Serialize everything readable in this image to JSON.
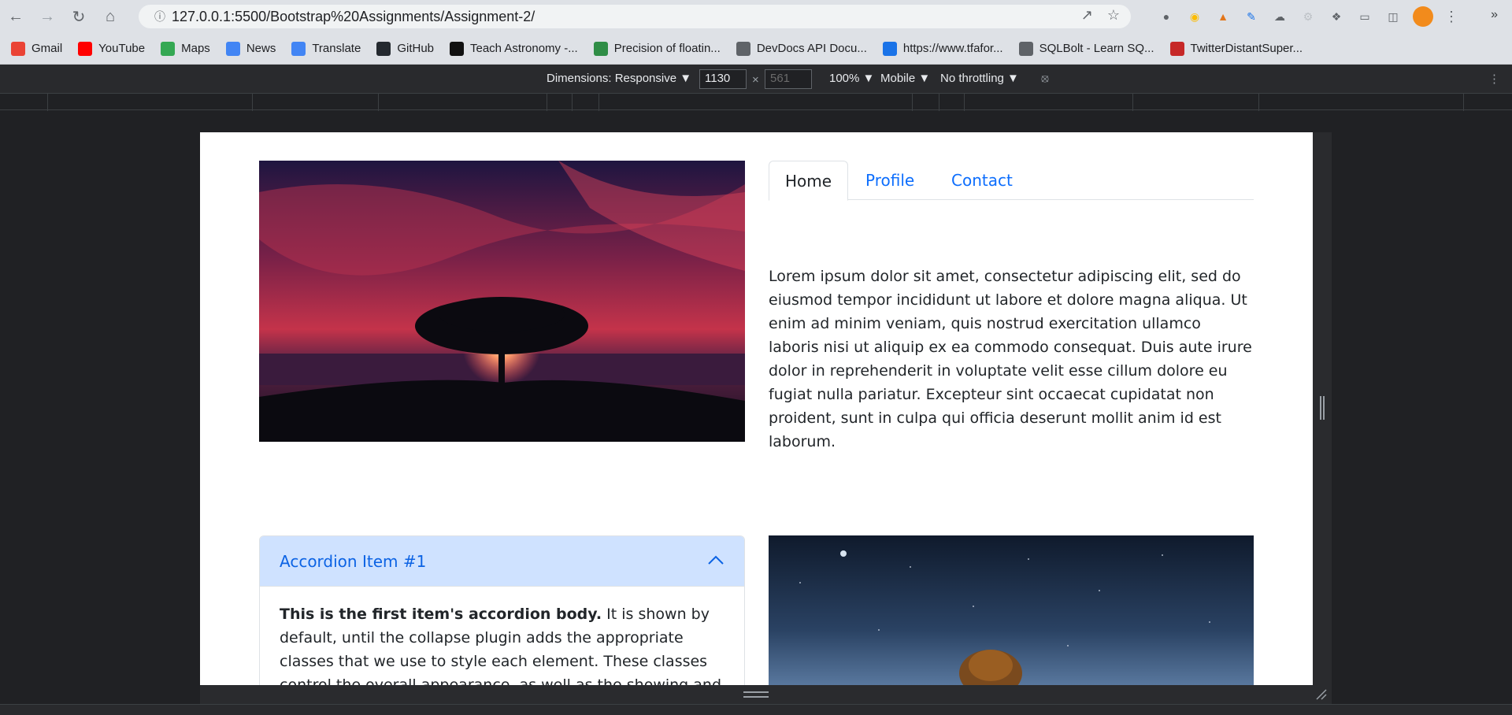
{
  "browser": {
    "url": "127.0.0.1:5500/Bootstrap%20Assignments/Assignment-2/",
    "bookmarks": [
      {
        "label": "Gmail",
        "color": "#ea4335"
      },
      {
        "label": "YouTube",
        "color": "#ff0000"
      },
      {
        "label": "Maps",
        "color": "#34a853"
      },
      {
        "label": "News",
        "color": "#4285f4"
      },
      {
        "label": "Translate",
        "color": "#4285f4"
      },
      {
        "label": "GitHub",
        "color": "#24292f"
      },
      {
        "label": "Teach Astronomy -...",
        "color": "#111111"
      },
      {
        "label": "Precision of floatin...",
        "color": "#2f8d46"
      },
      {
        "label": "DevDocs API Docu...",
        "color": "#5f6368"
      },
      {
        "label": "https://www.tfafor...",
        "color": "#1a73e8"
      },
      {
        "label": "SQLBolt - Learn SQ...",
        "color": "#5f6368"
      },
      {
        "label": "TwitterDistantSuper...",
        "color": "#c62828"
      }
    ],
    "more": "»"
  },
  "devtools": {
    "dimensions": "Dimensions: Responsive ▼",
    "width": "1130",
    "times": "×",
    "height": "561",
    "zoom": "100% ▼",
    "device": "Mobile ▼",
    "throttle": "No throttling ▼"
  },
  "page": {
    "tabs": [
      {
        "label": "Home"
      },
      {
        "label": "Profile"
      },
      {
        "label": "Contact"
      }
    ],
    "paragraph": "Lorem ipsum dolor sit amet, consectetur adipiscing elit, sed do eiusmod tempor incididunt ut labore et dolore magna aliqua. Ut enim ad minim veniam, quis nostrud exercitation ullamco laboris nisi ut aliquip ex ea commodo consequat. Duis aute irure dolor in reprehenderit in voluptate velit esse cillum dolore eu fugiat nulla pariatur. Excepteur sint occaecat cupidatat non proident, sunt in culpa qui officia deserunt mollit anim id est laborum.",
    "accordion": {
      "title": "Accordion Item #1",
      "body_strong": "This is the first item's accordion body.",
      "body_text": " It is shown by default, until the collapse plugin adds the appropriate classes that we use to style each element. These classes control the overall appearance, as well as the showing and hiding via CSS transitions."
    }
  }
}
